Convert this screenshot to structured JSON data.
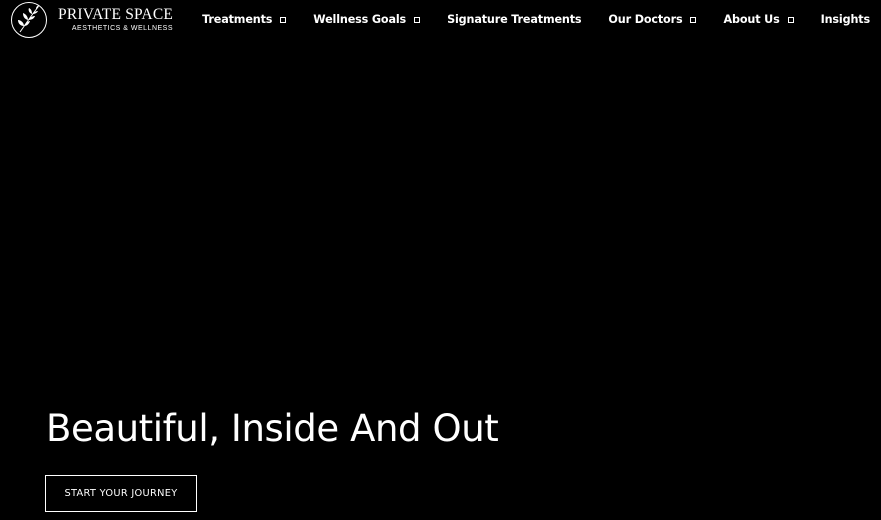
{
  "brand": {
    "name": "PRIVATE SPACE",
    "tagline": "AESTHETICS & WELLNESS",
    "logo_icon": "laurel-circle-icon"
  },
  "nav": {
    "items": [
      {
        "label": "Treatments",
        "has_dropdown": true
      },
      {
        "label": "Wellness Goals",
        "has_dropdown": true
      },
      {
        "label": "Signature Treatments",
        "has_dropdown": false
      },
      {
        "label": "Our Doctors",
        "has_dropdown": true
      },
      {
        "label": "About Us",
        "has_dropdown": true
      },
      {
        "label": "Insights",
        "has_dropdown": false
      }
    ],
    "dropdown_icon": "square-caret-icon"
  },
  "hero": {
    "title": "Beautiful, Inside And Out",
    "cta_label": "START YOUR JOURNEY"
  },
  "colors": {
    "background": "#000000",
    "text": "#ffffff"
  }
}
